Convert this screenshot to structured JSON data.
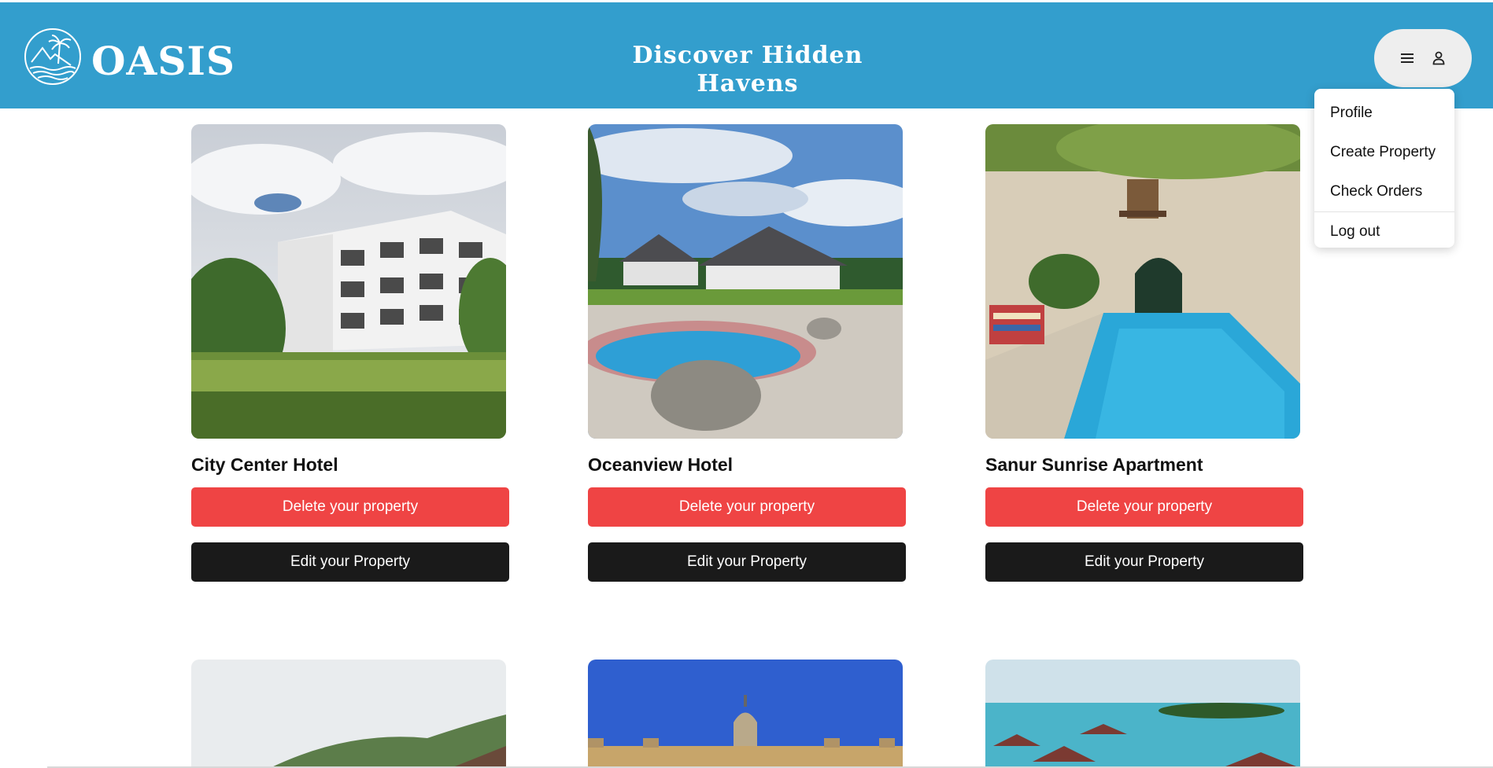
{
  "header": {
    "logo_text": "OASIS",
    "tagline": "Discover Hidden Havens",
    "background_color": "#339ecd"
  },
  "user_menu": {
    "icons": [
      "hamburger-icon",
      "user-icon"
    ],
    "items": [
      {
        "label": "Profile"
      },
      {
        "label": "Create Property"
      },
      {
        "label": "Check Orders"
      },
      {
        "label": "Log out"
      }
    ]
  },
  "properties": [
    {
      "name": "City Center Hotel",
      "delete_label": "Delete your property",
      "edit_label": "Edit your Property"
    },
    {
      "name": "Oceanview Hotel",
      "delete_label": "Delete your property",
      "edit_label": "Edit your Property"
    },
    {
      "name": "Sanur Sunrise Apartment",
      "delete_label": "Delete your property",
      "edit_label": "Edit your Property"
    }
  ],
  "colors": {
    "delete": "#ef4444",
    "edit": "#1a1a1a"
  }
}
